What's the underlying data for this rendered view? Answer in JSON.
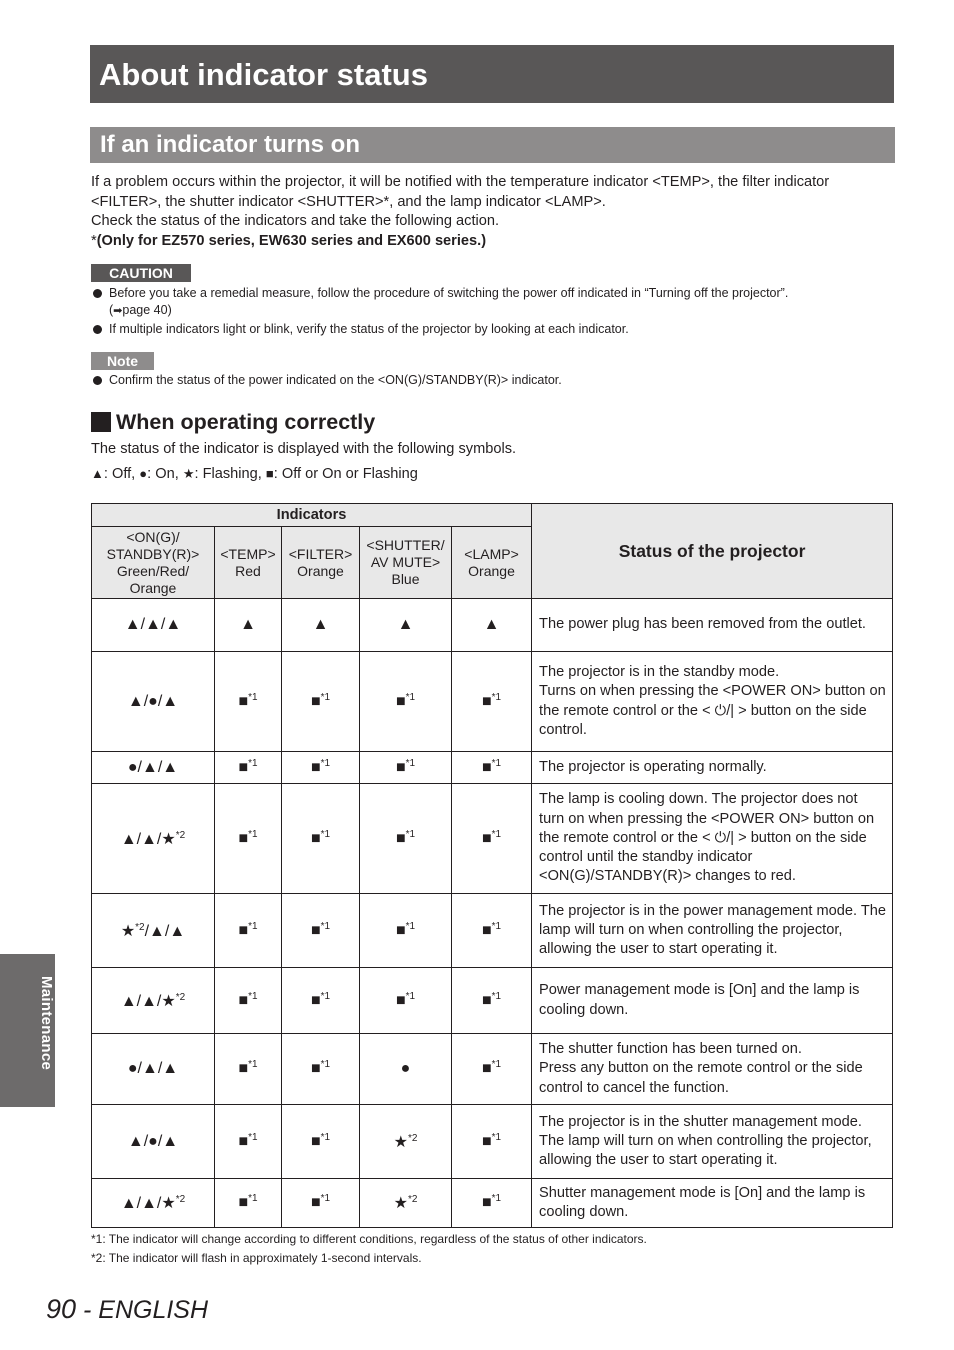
{
  "page_title": "About indicator status",
  "section_title": "If an indicator turns on",
  "intro": {
    "line1": "If a problem occurs within the projector, it will be notified with the temperature indicator <TEMP>, the filter indicator <FILTER>, the shutter indicator <SHUTTER>*, and the lamp indicator <LAMP>.",
    "line2": "Check the status of the indicators and take the following action.",
    "asterisk": "*",
    "model_note": "(Only for EZ570 series, EW630 series and EX600 series.)"
  },
  "caution": {
    "label": "CAUTION",
    "items": [
      {
        "text": "Before you take a remedial measure, follow the procedure of switching the power off indicated in “Turning off the projector”.",
        "ref_prefix": "(",
        "ref_icon": "arrow-right-icon",
        "ref_text": "page 40)"
      },
      {
        "text": "If multiple indicators light or blink, verify the status of the projector by looking at each indicator."
      }
    ]
  },
  "note": {
    "label": "Note",
    "items": [
      {
        "text": "Confirm the status of the power indicated on the <ON(G)/STANDBY(R)> indicator."
      }
    ]
  },
  "subsection": {
    "title": "When operating correctly",
    "description": "The status of the indicator is displayed with the following symbols.",
    "legend": [
      {
        "symbol": "▲",
        "meaning": ": Off, "
      },
      {
        "symbol": "●",
        "meaning": ": On, "
      },
      {
        "symbol": "★",
        "meaning": ": Flashing, "
      },
      {
        "symbol": "■",
        "meaning": ": Off or On or Flashing"
      }
    ]
  },
  "table": {
    "group_header": "Indicators",
    "status_header": "Status of the projector",
    "columns": [
      "<ON(G)/ STANDBY(R)> Green/Red/ Orange",
      "<TEMP> Red",
      "<FILTER> Orange",
      "<SHUTTER/ AV MUTE> Blue",
      "<LAMP> Orange"
    ],
    "column_lines": [
      [
        "<ON(G)/",
        "STANDBY(R)>",
        "Green/Red/",
        "Orange"
      ],
      [
        "<TEMP>",
        "Red"
      ],
      [
        "<FILTER>",
        "Orange"
      ],
      [
        "<SHUTTER/",
        "AV MUTE>",
        "Blue"
      ],
      [
        "<LAMP>",
        "Orange"
      ]
    ],
    "rows": [
      {
        "power": "▲/▲/▲",
        "power_sup": "",
        "temp": "▲",
        "temp_sup": "",
        "filter": "▲",
        "filter_sup": "",
        "shutter": "▲",
        "shutter_sup": "",
        "lamp": "▲",
        "lamp_sup": "",
        "status": [
          "The power plug has been removed from the outlet."
        ]
      },
      {
        "power": "▲/●/▲",
        "power_sup": "",
        "temp": "■",
        "temp_sup": "*1",
        "filter": "■",
        "filter_sup": "*1",
        "shutter": "■",
        "shutter_sup": "*1",
        "lamp": "■",
        "lamp_sup": "*1",
        "status": [
          "The projector is in the standby mode.",
          "Turns on when pressing the <POWER ON> button on the remote control or the < ⏻/| > button on the side control."
        ]
      },
      {
        "power": "●/▲/▲",
        "power_sup": "",
        "temp": "■",
        "temp_sup": "*1",
        "filter": "■",
        "filter_sup": "*1",
        "shutter": "■",
        "shutter_sup": "*1",
        "lamp": "■",
        "lamp_sup": "*1",
        "status": [
          "The projector is operating normally."
        ]
      },
      {
        "power": "▲/▲/★",
        "power_sup": "*2",
        "temp": "■",
        "temp_sup": "*1",
        "filter": "■",
        "filter_sup": "*1",
        "shutter": "■",
        "shutter_sup": "*1",
        "lamp": "■",
        "lamp_sup": "*1",
        "status": [
          "The lamp is cooling down. The projector does not turn on when pressing the <POWER ON> button on the remote control or the < ⏻/| > button on the side control until the standby indicator <ON(G)/STANDBY(R)> changes to red."
        ]
      },
      {
        "power": "★",
        "power_sup": "*2",
        "power_suffix": "/▲/▲",
        "temp": "■",
        "temp_sup": "*1",
        "filter": "■",
        "filter_sup": "*1",
        "shutter": "■",
        "shutter_sup": "*1",
        "lamp": "■",
        "lamp_sup": "*1",
        "status": [
          "The projector is in the power management mode. The lamp will turn on when controlling the projector, allowing the user to start operating it."
        ]
      },
      {
        "power": "▲/▲/★",
        "power_sup": "*2",
        "temp": "■",
        "temp_sup": "*1",
        "filter": "■",
        "filter_sup": "*1",
        "shutter": "■",
        "shutter_sup": "*1",
        "lamp": "■",
        "lamp_sup": "*1",
        "status": [
          "Power management mode is [On] and the lamp is cooling down."
        ]
      },
      {
        "power": "●/▲/▲",
        "power_sup": "",
        "temp": "■",
        "temp_sup": "*1",
        "filter": "■",
        "filter_sup": "*1",
        "shutter": "●",
        "shutter_sup": "",
        "lamp": "■",
        "lamp_sup": "*1",
        "status": [
          "The shutter function has been turned on.",
          "Press any button on the remote control or the side control to cancel the function."
        ]
      },
      {
        "power": "▲/●/▲",
        "power_sup": "",
        "temp": "■",
        "temp_sup": "*1",
        "filter": "■",
        "filter_sup": "*1",
        "shutter": "★",
        "shutter_sup": "*2",
        "lamp": "■",
        "lamp_sup": "*1",
        "status": [
          "The projector is in the shutter management mode. The lamp will turn on when controlling the projector, allowing the user to start operating it."
        ]
      },
      {
        "power": "▲/▲/★",
        "power_sup": "*2",
        "temp": "■",
        "temp_sup": "*1",
        "filter": "■",
        "filter_sup": "*1",
        "shutter": "★",
        "shutter_sup": "*2",
        "lamp": "■",
        "lamp_sup": "*1",
        "status": [
          "Shutter management mode is [On] and the lamp is cooling down."
        ]
      }
    ]
  },
  "footnotes": [
    "*1: The indicator will change according to different conditions, regardless of the status of other indicators.",
    "*2: The indicator will flash in approximately 1-second intervals."
  ],
  "side_tab": "Maintenance",
  "page_number": "90",
  "language": " - ENGLISH"
}
